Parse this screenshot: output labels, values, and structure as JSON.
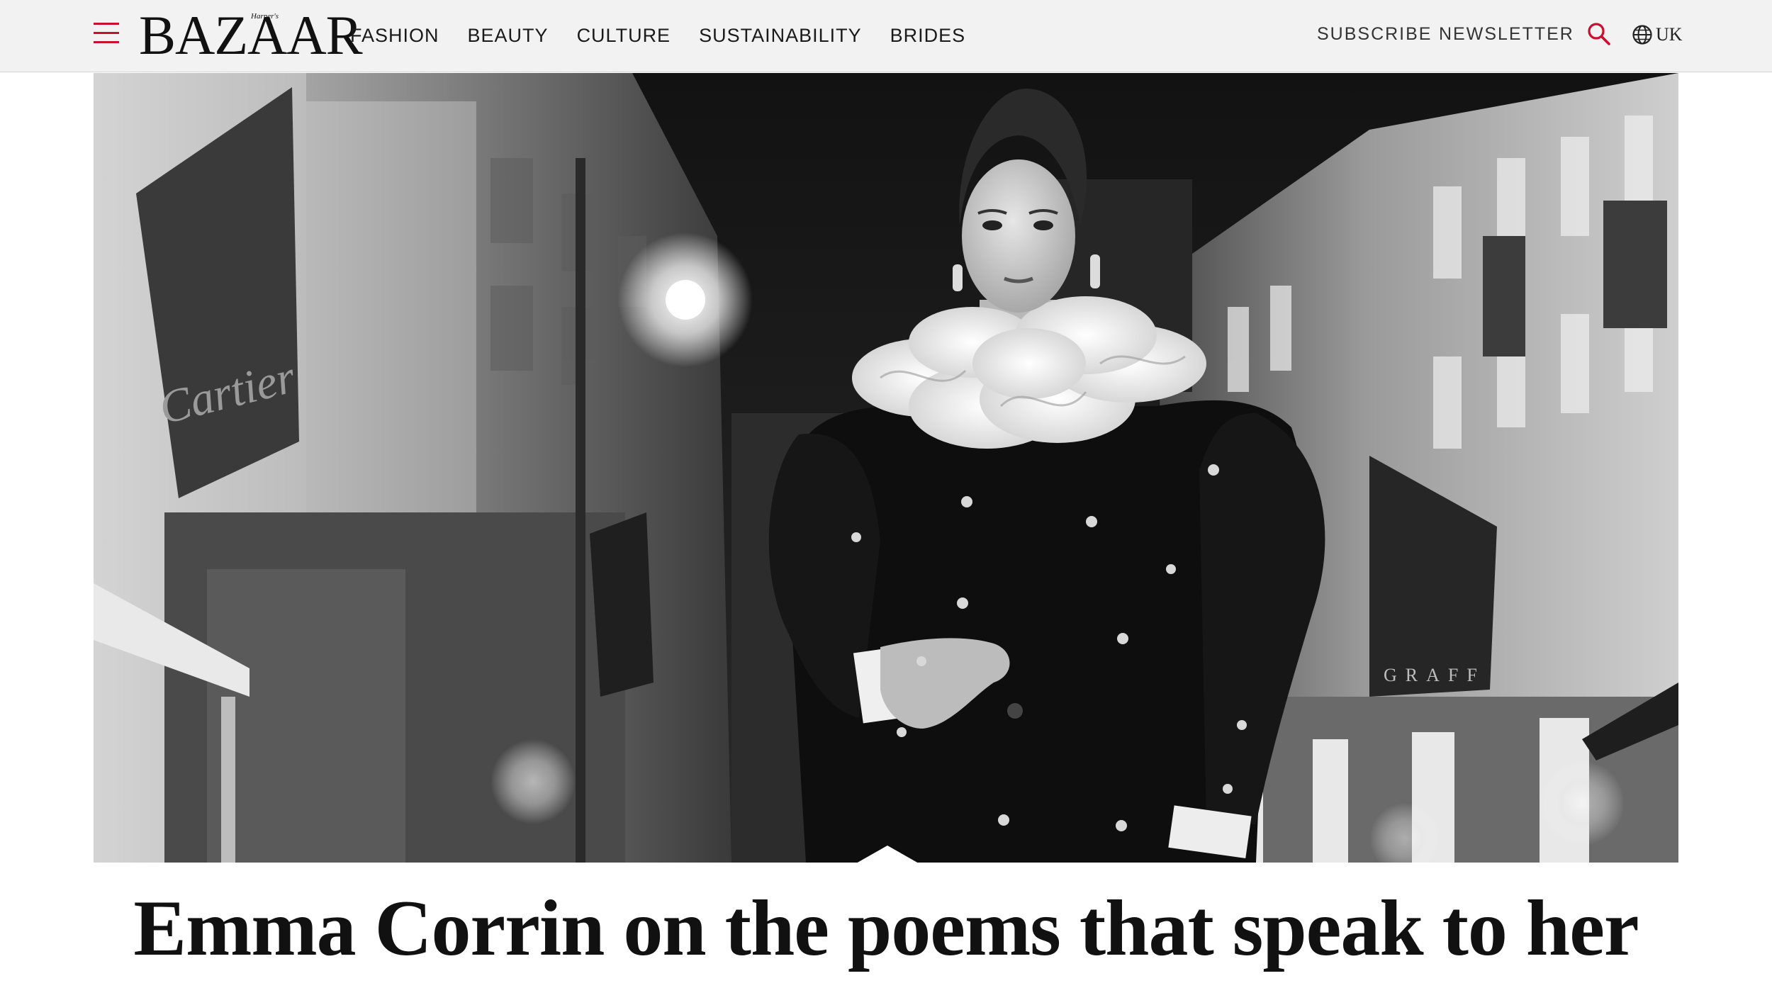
{
  "brand": {
    "logo_text": "BAZAAR",
    "logo_small": "Harper's"
  },
  "icons": {
    "menu": "hamburger-menu-icon",
    "search": "search-icon",
    "region": "globe-icon"
  },
  "colors": {
    "accent": "#c8102e",
    "header_bg": "#f2f2f2",
    "text": "#1a1a1a"
  },
  "nav": {
    "items": [
      "FASHION",
      "BEAUTY",
      "CULTURE",
      "SUSTAINABILITY",
      "BRIDES"
    ]
  },
  "utility": {
    "subscribe": "SUBSCRIBE",
    "newsletter": "NEWSLETTER",
    "region": "UK"
  },
  "hero": {
    "signage": [
      "Cartier",
      "GRAFF"
    ]
  },
  "article": {
    "headline": "Emma Corrin on the poems that speak to her"
  }
}
